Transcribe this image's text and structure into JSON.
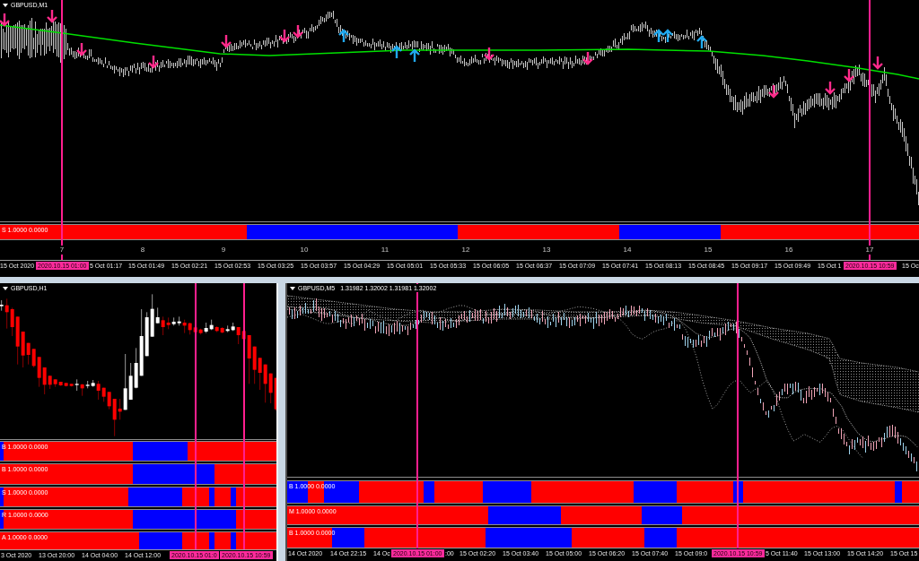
{
  "top_chart": {
    "title": "GBPUSD,M1",
    "indicators": [
      {
        "label": "S 1.0000 0.0000"
      }
    ],
    "number_labels": [
      "7",
      "8",
      "9",
      "10",
      "11",
      "12",
      "13",
      "14",
      "15",
      "16",
      "17"
    ],
    "time_axis": {
      "labels": [
        "15 Oct 2020",
        "5 Oct 01:17",
        "15 Oct 01:49",
        "15 Oct 02:21",
        "15 Oct 02:53",
        "15 Oct 03:25",
        "15 Oct 03:57",
        "15 Oct 04:29",
        "15 Oct 05:01",
        "15 Oct 05:33",
        "15 Oct 06:05",
        "15 Oct 06:37",
        "15 Oct 07:09",
        "15 Oct 07:41",
        "15 Oct 08:13",
        "15 Oct 08:45",
        "15 Oct 09:17",
        "15 Oct 09:49",
        "15 Oct 1",
        "15 Oc"
      ],
      "markers": [
        "2020.10.15 01:00",
        "2020.10.15 10:59"
      ]
    }
  },
  "bottom_left_chart": {
    "title": "GBPUSD,H1",
    "indicators": [
      {
        "label": "B 1.0000 0.0000"
      },
      {
        "label": "B 1.0000 0.0000"
      },
      {
        "label": "S 1.0000 0.0000"
      },
      {
        "label": "R 1.0000 0.0000"
      },
      {
        "label": "A 1.0000 0.0000"
      }
    ],
    "time_axis": {
      "labels": [
        "3 Oct 2020",
        "13 Oct 20:00",
        "14 Oct 04:00",
        "14 Oct 12:00"
      ],
      "markers": [
        "2020.10.15 01:0",
        "2020.10.15 10:59"
      ]
    }
  },
  "bottom_right_chart": {
    "title": "GBPUSD,M5",
    "quote": "1.31982 1.32002 1.31981 1.32002",
    "indicators": [
      {
        "label": "B 1.0000 0.0000"
      },
      {
        "label": "M 1.0000 0.0000"
      },
      {
        "label": "B 1.0000 0.0000"
      }
    ],
    "time_axis": {
      "labels": [
        "14 Oct 2020",
        "14 Oct 22:15",
        "14 Oc",
        ":00",
        "15 Oct 02:20",
        "15 Oct 03:40",
        "15 Oct 05:00",
        "15 Oct 06:20",
        "15 Oct 07:40",
        "15 Oct 09:0",
        "5 Oct 11:40",
        "15 Oct 13:00",
        "15 Oct 14:20",
        "15 Oct 15"
      ],
      "markers": [
        "2020.10.15 01:00",
        "2020.10.15 10:59"
      ]
    }
  }
}
